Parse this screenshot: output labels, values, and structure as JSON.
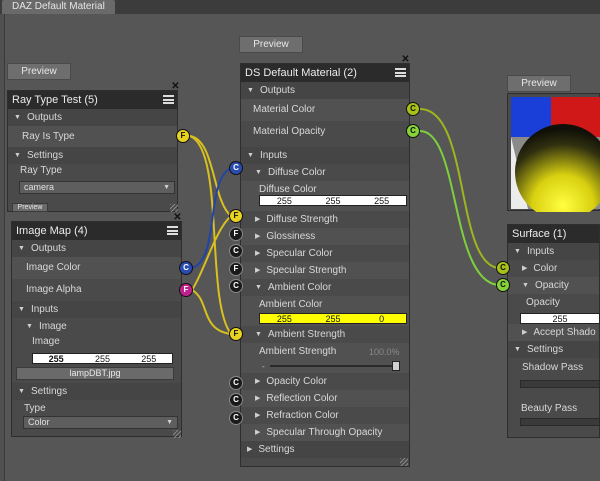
{
  "window": {
    "tab_title": "DAZ Default Material"
  },
  "ray_type_node": {
    "preview_label": "Preview",
    "title": "Ray Type Test (5)",
    "outputs_label": "Outputs",
    "ray_is_type_label": "Ray Is Type",
    "settings_label": "Settings",
    "ray_type_label": "Ray Type",
    "ray_type_value": "camera",
    "hidden_button_label": "Preview",
    "port_ray_is_type": "F"
  },
  "image_map_node": {
    "title": "Image Map (4)",
    "outputs_label": "Outputs",
    "image_color_label": "Image Color",
    "image_alpha_label": "Image Alpha",
    "inputs_label": "Inputs",
    "image_group_label": "Image",
    "image_label": "Image",
    "image_values": [
      "255",
      "255",
      "255"
    ],
    "image_file": "lampDBT.jpg",
    "settings_label": "Settings",
    "type_label": "Type",
    "type_value": "Color",
    "port_color": "C",
    "port_alpha": "F"
  },
  "ds_default_node": {
    "preview_label": "Preview",
    "title": "DS Default Material (2)",
    "outputs_label": "Outputs",
    "material_color_label": "Material Color",
    "material_opacity_label": "Material Opacity",
    "inputs_label": "Inputs",
    "diffuse_color_label": "Diffuse Color",
    "diffuse_color_sub": "Diffuse Color",
    "diffuse_values": [
      "255",
      "255",
      "255"
    ],
    "diffuse_strength_label": "Diffuse Strength",
    "glossiness_label": "Glossiness",
    "specular_color_label": "Specular Color",
    "specular_strength_label": "Specular Strength",
    "ambient_color_label": "Ambient Color",
    "ambient_color_sub": "Ambient Color",
    "ambient_values": [
      "255",
      "255",
      "0"
    ],
    "ambient_strength_label": "Ambient Strength",
    "ambient_strength_sub": "Ambient Strength",
    "ambient_strength_value": "100.0%",
    "ambient_strength_level": 1.0,
    "opacity_color_label": "Opacity Color",
    "reflection_color_label": "Reflection Color",
    "refraction_color_label": "Refraction Color",
    "specular_through_opacity_label": "Specular Through Opacity",
    "settings_label": "Settings",
    "port_c": "C",
    "port_f": "F"
  },
  "surface_node": {
    "preview_label": "Preview",
    "title": "Surface (1)",
    "inputs_label": "Inputs",
    "color_label": "Color",
    "opacity_group_label": "Opacity",
    "opacity_label": "Opacity",
    "opacity_value": "255",
    "accept_shadows_label": "Accept Shado",
    "settings_label": "Settings",
    "shadow_pass_label": "Shadow Pass",
    "beauty_pass_label": "Beauty Pass",
    "port_c": "C"
  },
  "colors": {
    "wire_yellow": "#d8c020",
    "wire_blue": "#2244a8",
    "wire_olive": "#9fb41e",
    "wire_green": "#7ecf3c",
    "ambient_yellow": "#ffff00"
  }
}
